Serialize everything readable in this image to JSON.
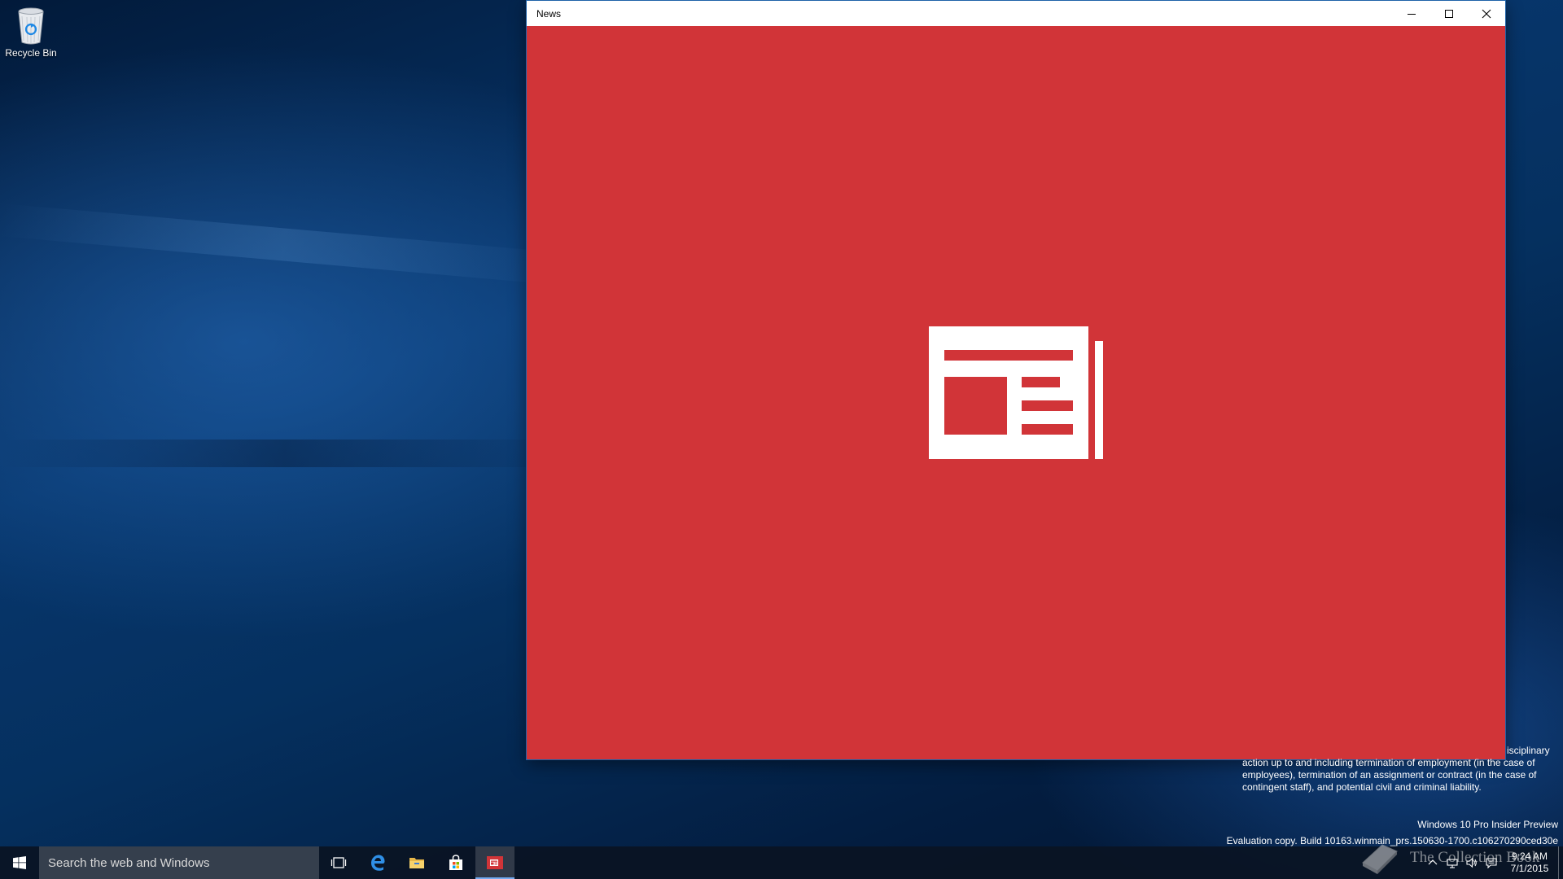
{
  "desktop": {
    "icons": [
      {
        "label": "Recycle Bin",
        "icon": "recycle-bin-icon"
      }
    ]
  },
  "window": {
    "title": "News",
    "controls": {
      "minimize": "minimize-icon",
      "maximize": "maximize-icon",
      "close": "close-icon"
    },
    "background_color": "#d13438",
    "splash_icon": "newspaper-icon"
  },
  "watermark": {
    "legal_text": "action up to and including termination of employment (in the case of employees), termination of an assignment or contract (in the case of contingent staff), and potential civil and criminal liability.",
    "legal_partial_prefix": "isciplinary",
    "edition": "Windows 10 Pro Insider Preview",
    "build": "Evaluation copy. Build 10163.winmain_prs.150630-1700.c106270290ced30e",
    "logo_text": "The Collection Book"
  },
  "taskbar": {
    "search_placeholder": "Search the web and Windows",
    "pinned": [
      {
        "name": "task-view",
        "icon": "task-view-icon"
      },
      {
        "name": "edge",
        "icon": "edge-icon"
      },
      {
        "name": "file-explorer",
        "icon": "folder-icon"
      },
      {
        "name": "store",
        "icon": "store-icon"
      },
      {
        "name": "news",
        "icon": "news-icon",
        "active": true
      }
    ],
    "tray": {
      "icons": [
        "chevron-up-icon",
        "network-icon",
        "volume-icon",
        "action-center-icon"
      ],
      "time": "9:24 AM",
      "date": "7/1/2015"
    }
  },
  "colors": {
    "news_red": "#d13438",
    "taskbar": "#0a1423",
    "desktop_blue": "#07366c"
  }
}
